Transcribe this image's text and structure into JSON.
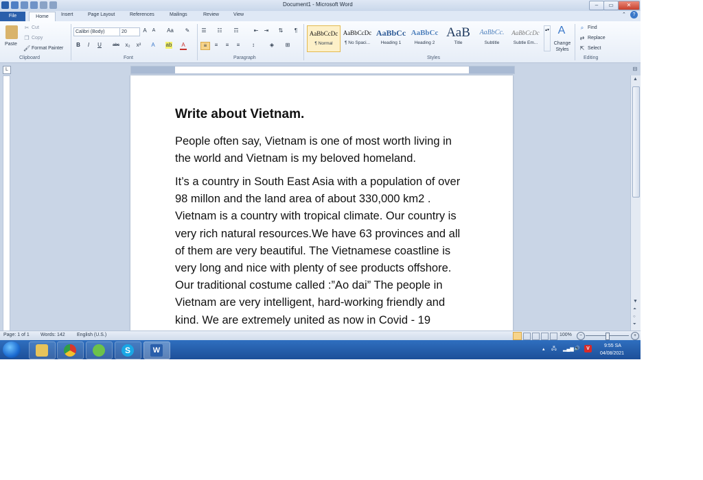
{
  "window": {
    "title": "Document1 - Microsoft Word"
  },
  "tabs": [
    "File",
    "Home",
    "Insert",
    "Page Layout",
    "References",
    "Mailings",
    "Review",
    "View"
  ],
  "clipboard": {
    "paste": "Paste",
    "cut": "Cut",
    "copy": "Copy",
    "format_painter": "Format Painter",
    "group_label": "Clipboard"
  },
  "font": {
    "name": "Calibri (Body)",
    "size": "20",
    "group_label": "Font"
  },
  "paragraph": {
    "group_label": "Paragraph"
  },
  "styles": {
    "group_label": "Styles",
    "items": [
      {
        "sample": "AaBbCcDc",
        "name": "¶ Normal"
      },
      {
        "sample": "AaBbCcDc",
        "name": "¶ No Spaci..."
      },
      {
        "sample": "AaBbCc",
        "name": "Heading 1"
      },
      {
        "sample": "AaBbCc",
        "name": "Heading 2"
      },
      {
        "sample": "AaB",
        "name": "Title"
      },
      {
        "sample": "AaBbCc.",
        "name": "Subtitle"
      },
      {
        "sample": "AaBbCcDc",
        "name": "Subtle Em..."
      }
    ],
    "change_styles": "Change Styles"
  },
  "editing": {
    "find": "Find",
    "replace": "Replace",
    "select": "Select",
    "group_label": "Editing"
  },
  "document": {
    "heading": "Write about Vietnam.",
    "paragraph1": [
      "People often say, Vietnam is one of most worth living in",
      "the world and Vietnam is my beloved homeland."
    ],
    "paragraph2": [
      "It’s a country in South East Asia with a population of over",
      "98 millon and the land area of about 330,000 km2 .",
      "Vietnam is a country with tropical climate. Our country is",
      "very rich natural resources.We have 63 provinces and all",
      "of them are very beautiful. The Vietnamese coastline is",
      "very long and nice with plenty of see products offshore.",
      "Our traditional costume called :”Ao dai” The people in",
      "Vietnam are very intelligent, hard-working  friendly and",
      "kind. We are extremely united as now in Covid - 19"
    ]
  },
  "status": {
    "page": "Page: 1 of 1",
    "words": "Words: 142",
    "language": "English (U.S.)",
    "zoom": "100%"
  },
  "taskbar": {
    "language": "V",
    "time": "9:55 SA",
    "date": "04/08/2021"
  },
  "colors": {
    "accent": "#2a5fab",
    "ribbon": "#e6edf7",
    "taskbar": "#1d4f99"
  }
}
